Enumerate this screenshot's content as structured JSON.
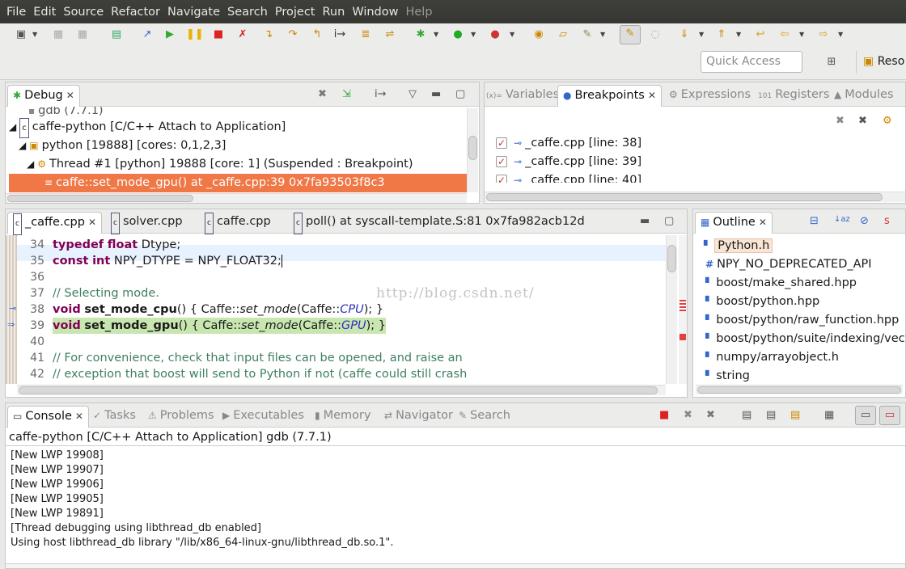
{
  "menu": [
    "File",
    "Edit",
    "Source",
    "Refactor",
    "Navigate",
    "Search",
    "Project",
    "Run",
    "Window",
    "Help"
  ],
  "quick_access": "Quick Access",
  "perspective_label": "Reso",
  "debug_view": {
    "title": "Debug",
    "tree": [
      "gdb (7.7.1)",
      "caffe-python [C/C++ Attach to Application]",
      "python [19888] [cores: 0,1,2,3]",
      "Thread #1 [python] 19888 [core: 1] (Suspended : Breakpoint)",
      "caffe::set_mode_gpu() at _caffe.cpp:39 0x7fa93503f8c3"
    ]
  },
  "right_views": {
    "tabs": [
      "Variables",
      "Breakpoints",
      "Expressions",
      "Registers",
      "Modules"
    ],
    "breakpoints": [
      "_caffe.cpp [line: 38]",
      "_caffe.cpp [line: 39]",
      "_caffe.cpp [line: 40]"
    ]
  },
  "editor": {
    "tabs": [
      "_caffe.cpp",
      "solver.cpp",
      "caffe.cpp",
      "poll() at syscall-template.S:81 0x7fa982acb12d"
    ],
    "lines": [
      {
        "n": "34",
        "t": "typedef float Dtype;"
      },
      {
        "n": "35",
        "t": "const int NPY_DTYPE = NPY_FLOAT32;"
      },
      {
        "n": "36",
        "t": ""
      },
      {
        "n": "37",
        "t": "// Selecting mode."
      },
      {
        "n": "38",
        "t": "void set_mode_cpu() { Caffe::set_mode(Caffe::CPU); }"
      },
      {
        "n": "39",
        "t": "void set_mode_gpu() { Caffe::set_mode(Caffe::GPU); }"
      },
      {
        "n": "40",
        "t": ""
      },
      {
        "n": "41",
        "t": "// For convenience, check that input files can be opened, and raise an"
      },
      {
        "n": "42",
        "t": "// exception that boost will send to Python if not (caffe could still crash"
      }
    ],
    "watermark": "http://blog.csdn.net/"
  },
  "outline": {
    "title": "Outline",
    "items": [
      "Python.h",
      "NPY_NO_DEPRECATED_API",
      "boost/make_shared.hpp",
      "boost/python.hpp",
      "boost/python/raw_function.hpp",
      "boost/python/suite/indexing/vec",
      "numpy/arrayobject.h",
      "string"
    ]
  },
  "bottom": {
    "tabs": [
      "Console",
      "Tasks",
      "Problems",
      "Executables",
      "Memory",
      "Navigator",
      "Search"
    ],
    "console_title": "caffe-python [C/C++ Attach to Application] gdb (7.7.1)",
    "console_lines": [
      "[New LWP 19908]",
      "[New LWP 19907]",
      "[New LWP 19906]",
      "[New LWP 19905]",
      "[New LWP 19891]",
      "[Thread debugging using libthread_db enabled]",
      "Using host libthread_db library \"/lib/x86_64-linux-gnu/libthread_db.so.1\"."
    ]
  },
  "colors": {
    "selection": "#f07746",
    "menubar": "#3a3a36",
    "keyword": "#7f0055",
    "comment": "#3f7f5f",
    "current_line": "#c8e6b0"
  }
}
